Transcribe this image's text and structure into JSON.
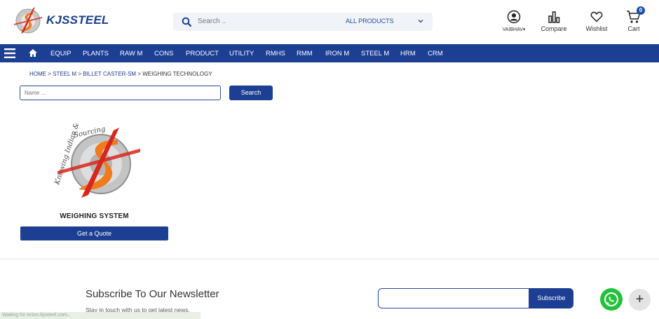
{
  "brand": {
    "name": "KJSSTEEL",
    "logo_icon": "kjssteel-logo-icon"
  },
  "header": {
    "search": {
      "placeholder": "Search ..",
      "category": "ALL PRODUCTS"
    },
    "account": {
      "label": "VAIBHAV"
    },
    "compare": {
      "label": "Compare"
    },
    "wishlist": {
      "label": "Wishlist"
    },
    "cart": {
      "label": "Cart",
      "count": "0"
    }
  },
  "nav": {
    "items": [
      "EQUIP",
      "PLANTS",
      "RAW M",
      "CONS",
      "PRODUCT",
      "UTILITY",
      "RMHS",
      "RMM",
      "IRON M",
      "STEEL M",
      "HRM",
      "CRM"
    ]
  },
  "breadcrumb": {
    "home": "HOME",
    "level1": "STEEL M",
    "level2": "BILLET CASTER-SM",
    "current": "WEIGHING TECHNOLOGY",
    "sep": ">"
  },
  "filter": {
    "placeholder": "Name ...",
    "button": "Search"
  },
  "product": {
    "title": "WEIGHING SYSTEM",
    "quote_button": "Get a Quote",
    "image_caption": "Knowing Indian & Sourcing"
  },
  "newsletter": {
    "title": "Subscribe To Our Newsletter",
    "subtitle": "Stay in touch with us to get latest news.",
    "button": "Subscribe"
  },
  "status": {
    "text": "Waiting for ecom.kjssteel.com..."
  },
  "float": {
    "plus": "+"
  },
  "colors": {
    "primary": "#1c3f94",
    "whatsapp": "#25c13d",
    "accent_orange": "#f07b1d",
    "accent_red": "#d8261c"
  }
}
